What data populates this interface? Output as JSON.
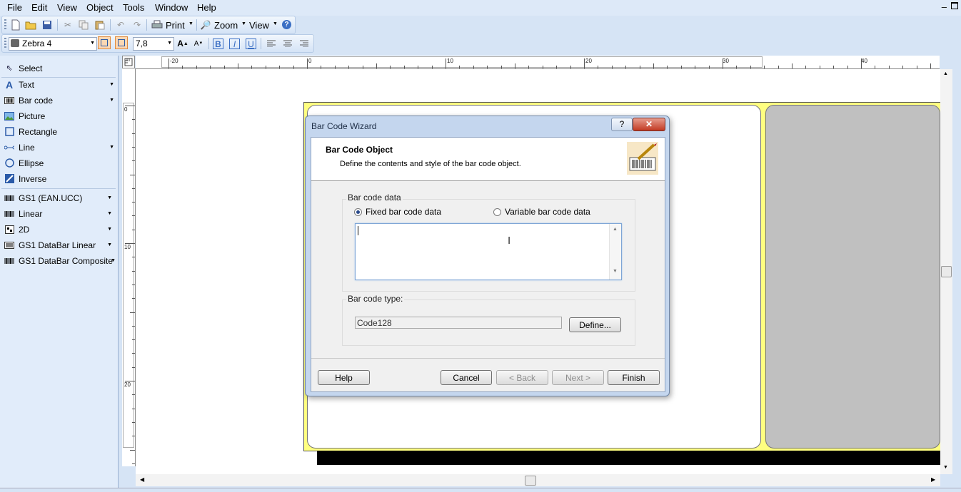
{
  "menu": {
    "file": "File",
    "edit": "Edit",
    "view": "View",
    "object": "Object",
    "tools": "Tools",
    "window": "Window",
    "help": "Help"
  },
  "toolbar1": {
    "print": "Print",
    "zoom": "Zoom",
    "view": "View"
  },
  "toolbar2": {
    "printer": "Zebra 4",
    "font_size": "7,8",
    "bold": "B",
    "italic": "I",
    "underline": "U"
  },
  "leftpanel": {
    "items": [
      {
        "label": "Select"
      },
      {
        "label": "Text"
      },
      {
        "label": "Bar code"
      },
      {
        "label": "Picture"
      },
      {
        "label": "Rectangle"
      },
      {
        "label": "Line"
      },
      {
        "label": "Ellipse"
      },
      {
        "label": "Inverse"
      },
      {
        "label": "GS1 (EAN.UCC)"
      },
      {
        "label": "Linear"
      },
      {
        "label": "2D"
      },
      {
        "label": "GS1 DataBar Linear"
      },
      {
        "label": "GS1 DataBar Composite"
      }
    ]
  },
  "hruler": {
    "labels": [
      "-20",
      "0",
      "10",
      "20",
      "30",
      "40"
    ]
  },
  "vruler": {
    "labels": [
      "0",
      "10",
      "20"
    ]
  },
  "dialog": {
    "title": "Bar Code Wizard",
    "help_glyph": "?",
    "close_glyph": "✕",
    "header_title": "Bar Code Object",
    "header_desc": "Define the contents and style of the bar code object.",
    "group_data_title": "Bar code data",
    "radio_fixed": "Fixed bar code data",
    "radio_variable": "Variable bar code data",
    "data_value": "",
    "group_type_title": "Bar code type:",
    "type_value": "Code128",
    "define_label": "Define...",
    "help_label": "Help",
    "cancel_label": "Cancel",
    "back_label": "< Back",
    "next_label": "Next >",
    "finish_label": "Finish"
  },
  "colors": {
    "label_border": "#ffff80",
    "gray_panel": "#c0c0c0",
    "accent": "#2a4a8a"
  }
}
